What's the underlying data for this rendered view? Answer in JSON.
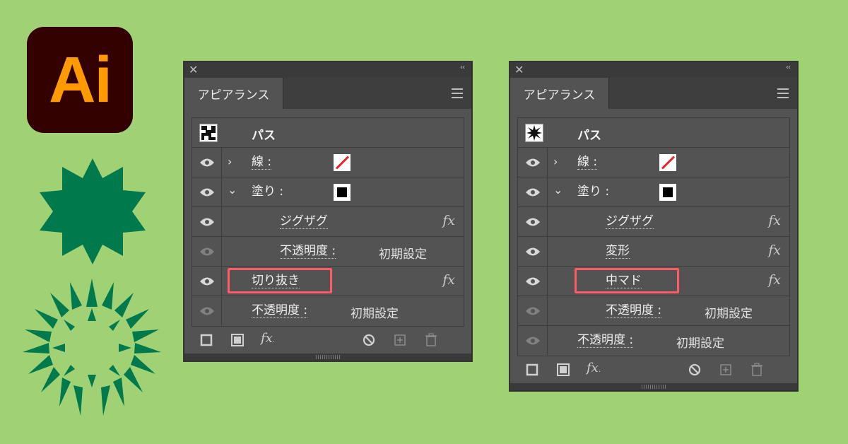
{
  "logo": {
    "text": "Ai",
    "bg": "#330000",
    "fg": "#ff9a00"
  },
  "colors": {
    "background": "#a0d175",
    "shape": "#007a4c",
    "highlight": "#ff5a66",
    "stroke_red": "#e3262d"
  },
  "panels": [
    {
      "tab": "アピアランス",
      "header": "パス",
      "rows": {
        "stroke_label": "線 :",
        "fill_label": "塗り :",
        "effect1": "ジグザグ",
        "opacity1_label": "不透明度 :",
        "opacity1_value": "初期設定",
        "effect2": "切り抜き",
        "opacity2_label": "不透明度 :",
        "opacity2_value": "初期設定"
      }
    },
    {
      "tab": "アピアランス",
      "header": "パス",
      "rows": {
        "stroke_label": "線 :",
        "fill_label": "塗り :",
        "effect1": "ジグザグ",
        "effect2": "変形",
        "effect3": "中マド",
        "opacity1_label": "不透明度 :",
        "opacity1_value": "初期設定",
        "opacity2_label": "不透明度 :",
        "opacity2_value": "初期設定"
      }
    }
  ],
  "fx_symbol": "fx",
  "icons": [
    "close-icon",
    "collapse-icon",
    "menu-icon",
    "eye-icon",
    "chevron-right-icon",
    "chevron-down-icon",
    "fx-icon",
    "new-stroke-icon",
    "new-fill-icon",
    "add-effect-icon",
    "clear-icon",
    "duplicate-icon",
    "delete-icon"
  ]
}
